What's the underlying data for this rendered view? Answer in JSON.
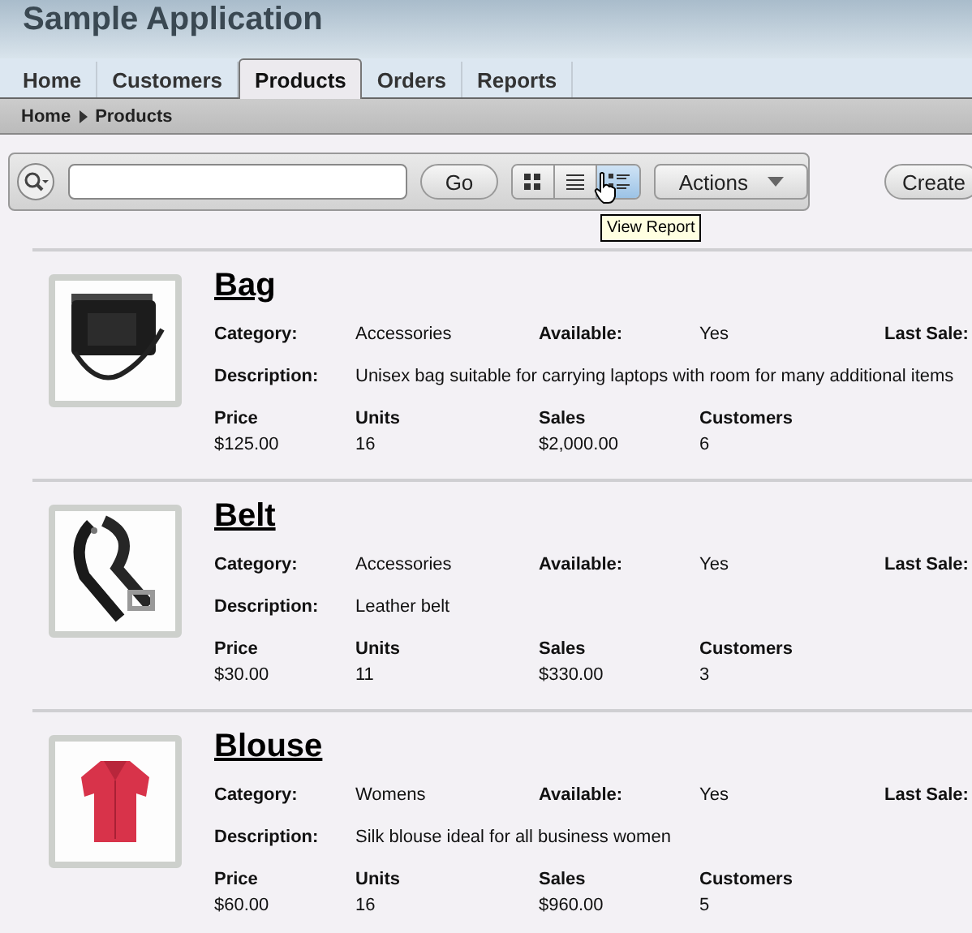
{
  "app": {
    "title": "Sample Application"
  },
  "tabs": [
    {
      "label": "Home",
      "selected": false
    },
    {
      "label": "Customers",
      "selected": false
    },
    {
      "label": "Products",
      "selected": true
    },
    {
      "label": "Orders",
      "selected": false
    },
    {
      "label": "Reports",
      "selected": false
    }
  ],
  "breadcrumb": [
    "Home",
    "Products"
  ],
  "toolbar": {
    "go_button": "Go",
    "views": [
      {
        "selected": false
      },
      {
        "selected": false
      },
      {
        "selected": true
      }
    ],
    "actions_button": "Actions",
    "create_button": "Create"
  },
  "tooltip": "View Report",
  "products": [
    {
      "name": "Bag",
      "info": [
        {
          "label": "Category:",
          "value": "Accessories"
        },
        {
          "label": "Available:",
          "value": "Yes"
        },
        {
          "label": "Last Sale:"
        }
      ],
      "description": {
        "label": "Description:",
        "value": "Unisex bag suitable for carrying laptops with room for many additional items"
      },
      "stats": [
        {
          "label": "Price",
          "value": "$125.00"
        },
        {
          "label": "Units",
          "value": "16"
        },
        {
          "label": "Sales",
          "value": "$2,000.00"
        },
        {
          "label": "Customers",
          "value": "6"
        }
      ]
    },
    {
      "name": "Belt",
      "info": [
        {
          "label": "Category:",
          "value": "Accessories"
        },
        {
          "label": "Available:",
          "value": "Yes"
        },
        {
          "label": "Last Sale:"
        }
      ],
      "description": {
        "label": "Description:",
        "value": "Leather belt"
      },
      "stats": [
        {
          "label": "Price",
          "value": "$30.00"
        },
        {
          "label": "Units",
          "value": "11"
        },
        {
          "label": "Sales",
          "value": "$330.00"
        },
        {
          "label": "Customers",
          "value": "3"
        }
      ]
    },
    {
      "name": "Blouse",
      "info": [
        {
          "label": "Category:",
          "value": "Womens"
        },
        {
          "label": "Available:",
          "value": "Yes"
        },
        {
          "label": "Last Sale:"
        }
      ],
      "description": {
        "label": "Description:",
        "value": "Silk blouse ideal for all business women"
      },
      "stats": [
        {
          "label": "Price",
          "value": "$60.00"
        },
        {
          "label": "Units",
          "value": "16"
        },
        {
          "label": "Sales",
          "value": "$960.00"
        },
        {
          "label": "Customers",
          "value": "5"
        }
      ]
    }
  ]
}
